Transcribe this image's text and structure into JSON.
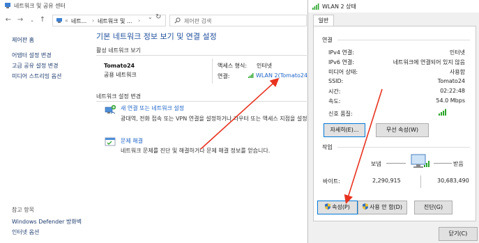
{
  "nsc": {
    "window_title": "네트워크 및 공유 센터",
    "breadcrumb": [
      "네트...",
      "네트워크 및 ..."
    ],
    "search_placeholder": "제어판 검색",
    "left_nav": {
      "home": "제어판 홈",
      "adapter": "어댑터 설정 변경",
      "sharing": "고급 공유 설정 변경",
      "media": "미디어 스트리밍 옵션",
      "see_also": "참고 항목",
      "defender": "Windows Defender 방화벽",
      "internet_options": "인터넷 옵션"
    },
    "main": {
      "title": "기본 네트워크 정보 보기 및 연결 설정",
      "active_networks_label": "활성 네트워크 보기",
      "network_name": "Tomato24",
      "network_type": "공용 네트워크",
      "access_type_label": "액세스 형식:",
      "access_type_value": "인터넷",
      "connections_label": "연결:",
      "connection_link": "WLAN 2(Tomato24)",
      "change_settings_label": "네트워크 설정 변경",
      "task1_link": "새 연결 또는 네트워크 설정",
      "task1_desc": "광대역, 전화 접속 또는 VPN 연결을 설정하거나 라우터 또는 액세스 지점을 설정합니다.",
      "task2_link": "문제 해결",
      "task2_desc": "네트워크 문제를 진단 및 해결하거나 문제 해결 정보를 얻습니다."
    }
  },
  "dialog": {
    "title": "WLAN 2 상태",
    "tab": "일반",
    "connection_group": "연결",
    "rows": [
      {
        "label": "IPv4 연결:",
        "value": "인터넷"
      },
      {
        "label": "IPv6 연결:",
        "value": "네트워크에 연결되어 있지 않음"
      },
      {
        "label": "미디어 상태:",
        "value": "사용함"
      },
      {
        "label": "SSID:",
        "value": "Tomato24"
      },
      {
        "label": "시간:",
        "value": "02:22:48"
      },
      {
        "label": "속도:",
        "value": "54.0 Mbps"
      }
    ],
    "signal_label": "신호 품질:",
    "signal_level": 1.0,
    "details_button": "자세히(E)...",
    "wireless_props_button": "무선 속성(W)",
    "activity_group": "작업",
    "sent_label": "보냄",
    "received_label": "받음",
    "bytes_label": "바이트:",
    "bytes_sent": "2,290,915",
    "bytes_received": "30,683,490",
    "properties_button": "속성(P)",
    "disable_button": "사용 안 함(D)",
    "diagnose_button": "진단(G)",
    "close_button": "닫기(C)"
  },
  "colors": {
    "link": "#1a62c8",
    "title": "#1f4e9c",
    "annotation_arrow": "#e8321e",
    "signal": "#2aa52a"
  },
  "icons": [
    "network-center-icon",
    "back-arrow-icon",
    "forward-arrow-icon",
    "up-arrow-icon",
    "refresh-icon",
    "search-icon",
    "wifi-signal-icon",
    "new-connection-icon",
    "troubleshoot-icon",
    "uac-shield-icon",
    "computer-activity-icon"
  ]
}
